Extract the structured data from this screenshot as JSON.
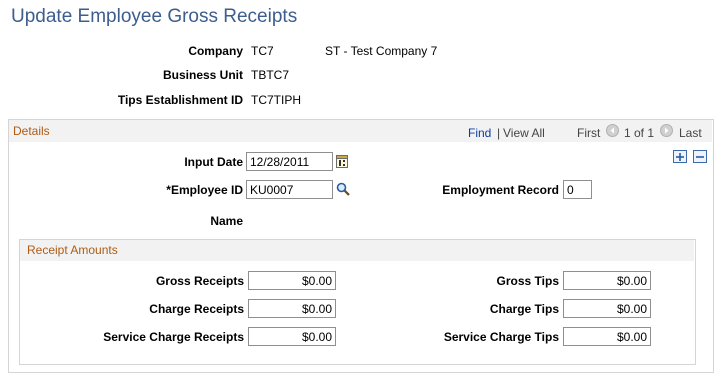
{
  "page": {
    "title": "Update Employee Gross Receipts"
  },
  "header": {
    "company_label": "Company",
    "company_code": "TC7",
    "company_name": "ST - Test Company 7",
    "business_unit_label": "Business Unit",
    "business_unit_value": "TBTC7",
    "tips_label": "Tips Establishment ID",
    "tips_value": "TC7TIPH"
  },
  "details": {
    "title": "Details",
    "nav": {
      "find": "Find",
      "separator": "|",
      "view_all": "View All",
      "first": "First",
      "range": "1 of 1",
      "last": "Last"
    },
    "input_date_label": "Input Date",
    "input_date_value": "12/28/2011",
    "employee_id_label": "*Employee ID",
    "employee_id_value": "KU0007",
    "employment_record_label": "Employment Record",
    "employment_record_value": "0",
    "name_label": "Name"
  },
  "receipts": {
    "title": "Receipt Amounts",
    "gross_receipts_label": "Gross Receipts",
    "gross_receipts_value": "$0.00",
    "charge_receipts_label": "Charge Receipts",
    "charge_receipts_value": "$0.00",
    "service_charge_receipts_label": "Service Charge Receipts",
    "service_charge_receipts_value": "$0.00",
    "gross_tips_label": "Gross Tips",
    "gross_tips_value": "$0.00",
    "charge_tips_label": "Charge Tips",
    "charge_tips_value": "$0.00",
    "service_charge_tips_label": "Service Charge Tips",
    "service_charge_tips_value": "$0.00"
  },
  "icons": {
    "calendar": "calendar-icon",
    "lookup": "magnifier-icon",
    "add": "plus-icon",
    "delete": "minus-icon",
    "prev": "left-arrow-icon",
    "next": "right-arrow-icon"
  },
  "colors": {
    "title": "#3d5d8f",
    "section_title": "#b05b14",
    "link": "#0a3ea0",
    "header_bg": "#f2f2f2"
  }
}
